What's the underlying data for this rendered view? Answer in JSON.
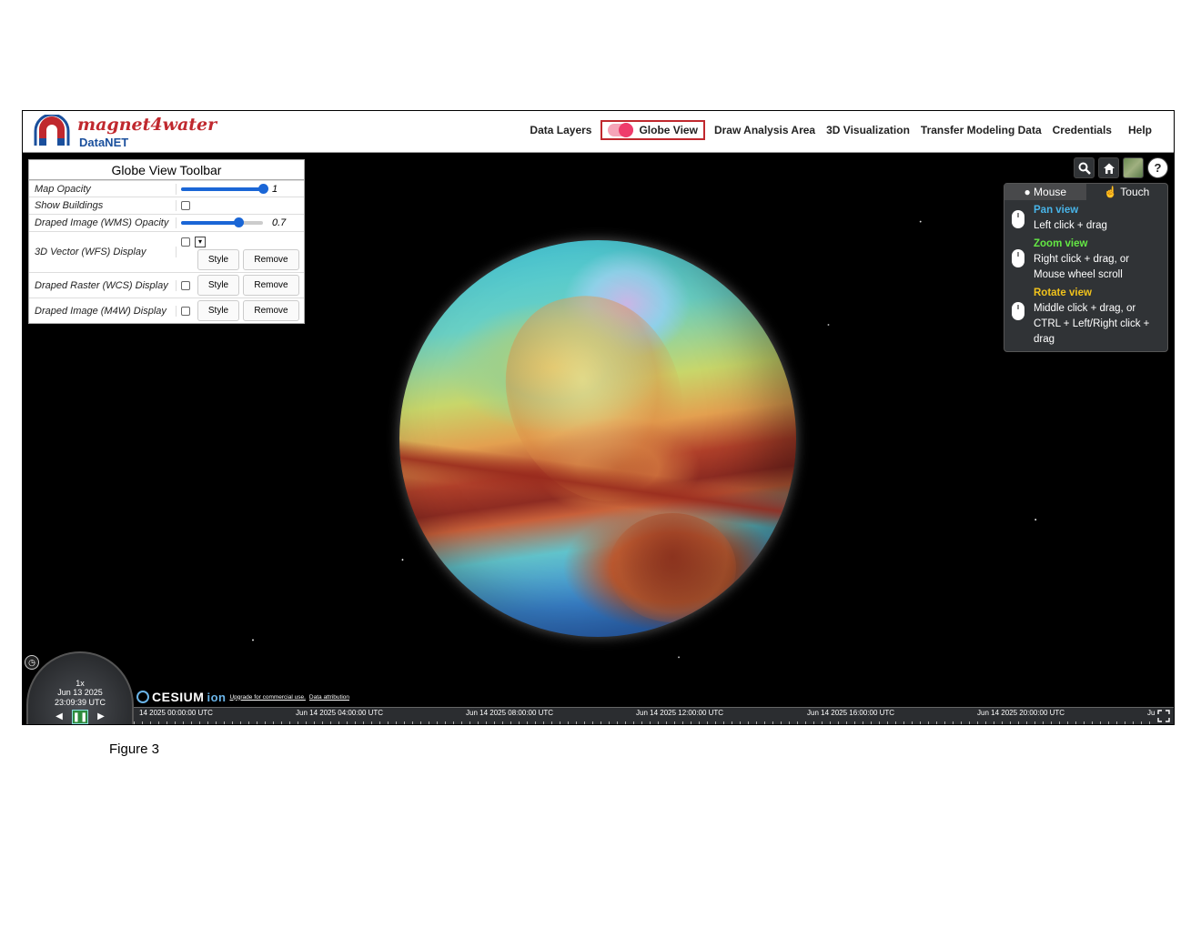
{
  "header": {
    "brand": "magnet4water",
    "brand_sub": "DataNET",
    "nav": {
      "data_layers": "Data Layers",
      "globe_view": "Globe View",
      "draw_area": "Draw Analysis Area",
      "visualization": "3D Visualization",
      "transfer": "Transfer Modeling Data",
      "credentials": "Credentials",
      "help": "Help"
    },
    "globe_toggle_on": true
  },
  "toolbar": {
    "title": "Globe View Toolbar",
    "map_opacity": {
      "label": "Map Opacity",
      "value": "1",
      "fraction": 1.0
    },
    "show_buildings": {
      "label": "Show Buildings",
      "checked": false
    },
    "wms_opacity": {
      "label": "Draped Image (WMS) Opacity",
      "value": "0.7",
      "fraction": 0.7
    },
    "wfs": {
      "label": "3D Vector (WFS) Display",
      "style": "Style",
      "remove": "Remove"
    },
    "wcs": {
      "label": "Draped Raster (WCS) Display",
      "style": "Style",
      "remove": "Remove"
    },
    "m4w": {
      "label": "Draped Image (M4W) Display",
      "style": "Style",
      "remove": "Remove"
    }
  },
  "help_panel": {
    "tab_mouse": "Mouse",
    "tab_touch": "Touch",
    "pan_title": "Pan view",
    "pan_text": "Left click + drag",
    "zoom_title": "Zoom view",
    "zoom_text": "Right click + drag, or Mouse wheel scroll",
    "rotate_title": "Rotate view",
    "rotate_text": "Middle click + drag, or CTRL + Left/Right click + drag",
    "colors": {
      "pan": "#48b4e8",
      "zoom": "#64e844",
      "rotate": "#f0c21c"
    }
  },
  "icons": [
    "search-icon",
    "home-icon",
    "imagery-layer-icon",
    "help-icon",
    "clock-icon",
    "fullscreen-icon"
  ],
  "clock": {
    "speed": "1x",
    "date": "Jun 13 2025",
    "time": "23:09:39 UTC"
  },
  "credit": {
    "cesium": "CESIUM",
    "ion": "ion",
    "upgrade": "Upgrade for commercial use.",
    "attribution": "Data attribution"
  },
  "timeline": {
    "labels": [
      "14 2025 00:00:00 UTC",
      "Jun 14 2025 04:00:00 UTC",
      "Jun 14 2025 08:00:00 UTC",
      "Jun 14 2025 12:00:00 UTC",
      "Jun 14 2025 16:00:00 UTC",
      "Jun 14 2025 20:00:00 UTC",
      "Ju"
    ]
  },
  "caption": "Figure 3"
}
